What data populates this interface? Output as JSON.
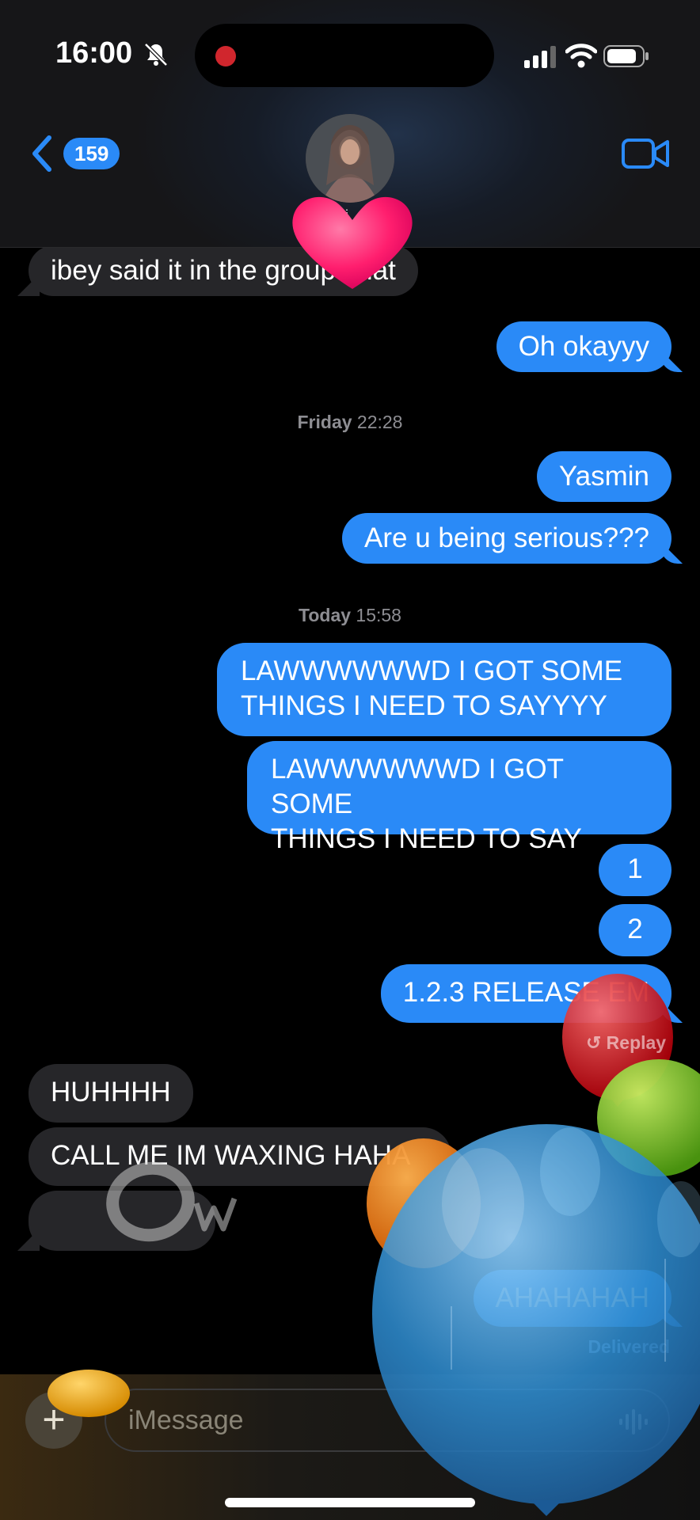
{
  "status_bar": {
    "time": "16:00",
    "icons": [
      "bell-slash-icon",
      "signal-icon",
      "wifi-icon",
      "battery-icon"
    ]
  },
  "header": {
    "back_count": "159",
    "contact_initial": "i",
    "icons": [
      "chevron-left-icon",
      "video-call-icon",
      "avatar"
    ]
  },
  "messages": [
    {
      "id": "m1",
      "side": "received",
      "text": "ibey said it in the group chat"
    },
    {
      "id": "m2",
      "side": "sent",
      "text": "Oh okayyy"
    },
    {
      "id": "ts1",
      "type": "timestamp",
      "day": "Friday",
      "time": "22:28"
    },
    {
      "id": "m3",
      "side": "sent",
      "text": "Yasmin"
    },
    {
      "id": "m4",
      "side": "sent",
      "text": "Are u being serious???"
    },
    {
      "id": "ts2",
      "type": "timestamp",
      "day": "Today",
      "time": "15:58"
    },
    {
      "id": "m5",
      "side": "sent",
      "line1": "LAWWWWWWD I GOT SOME",
      "line2": "THINGS I NEED TO SAYYYY"
    },
    {
      "id": "m6",
      "side": "sent",
      "line1": "LAWWWWWWD I GOT SOME",
      "line2": "THINGS I NEED TO SAY"
    },
    {
      "id": "m7",
      "side": "sent",
      "text": "1"
    },
    {
      "id": "m8",
      "side": "sent",
      "text": "2"
    },
    {
      "id": "m9",
      "side": "sent",
      "text": "1.2.3 RELEASE EM"
    },
    {
      "id": "m10",
      "side": "received",
      "text": "HUHHHH"
    },
    {
      "id": "m11",
      "side": "received",
      "text": "CALL ME IM WAXING HAHA"
    },
    {
      "id": "m12",
      "side": "received",
      "text": ""
    },
    {
      "id": "m13",
      "side": "sent",
      "text": "AHAHAHAH"
    }
  ],
  "replay_label": "Replay",
  "delivered_label": "Delivered",
  "composer": {
    "plus_label": "+",
    "placeholder": "iMessage"
  },
  "effects": {
    "types": [
      "heart",
      "balloons"
    ],
    "handwriting": "ow",
    "colors": {
      "sent_bubble": "#2a8af7",
      "received_bubble": "#262629",
      "heart": "#ff1e6e"
    }
  }
}
